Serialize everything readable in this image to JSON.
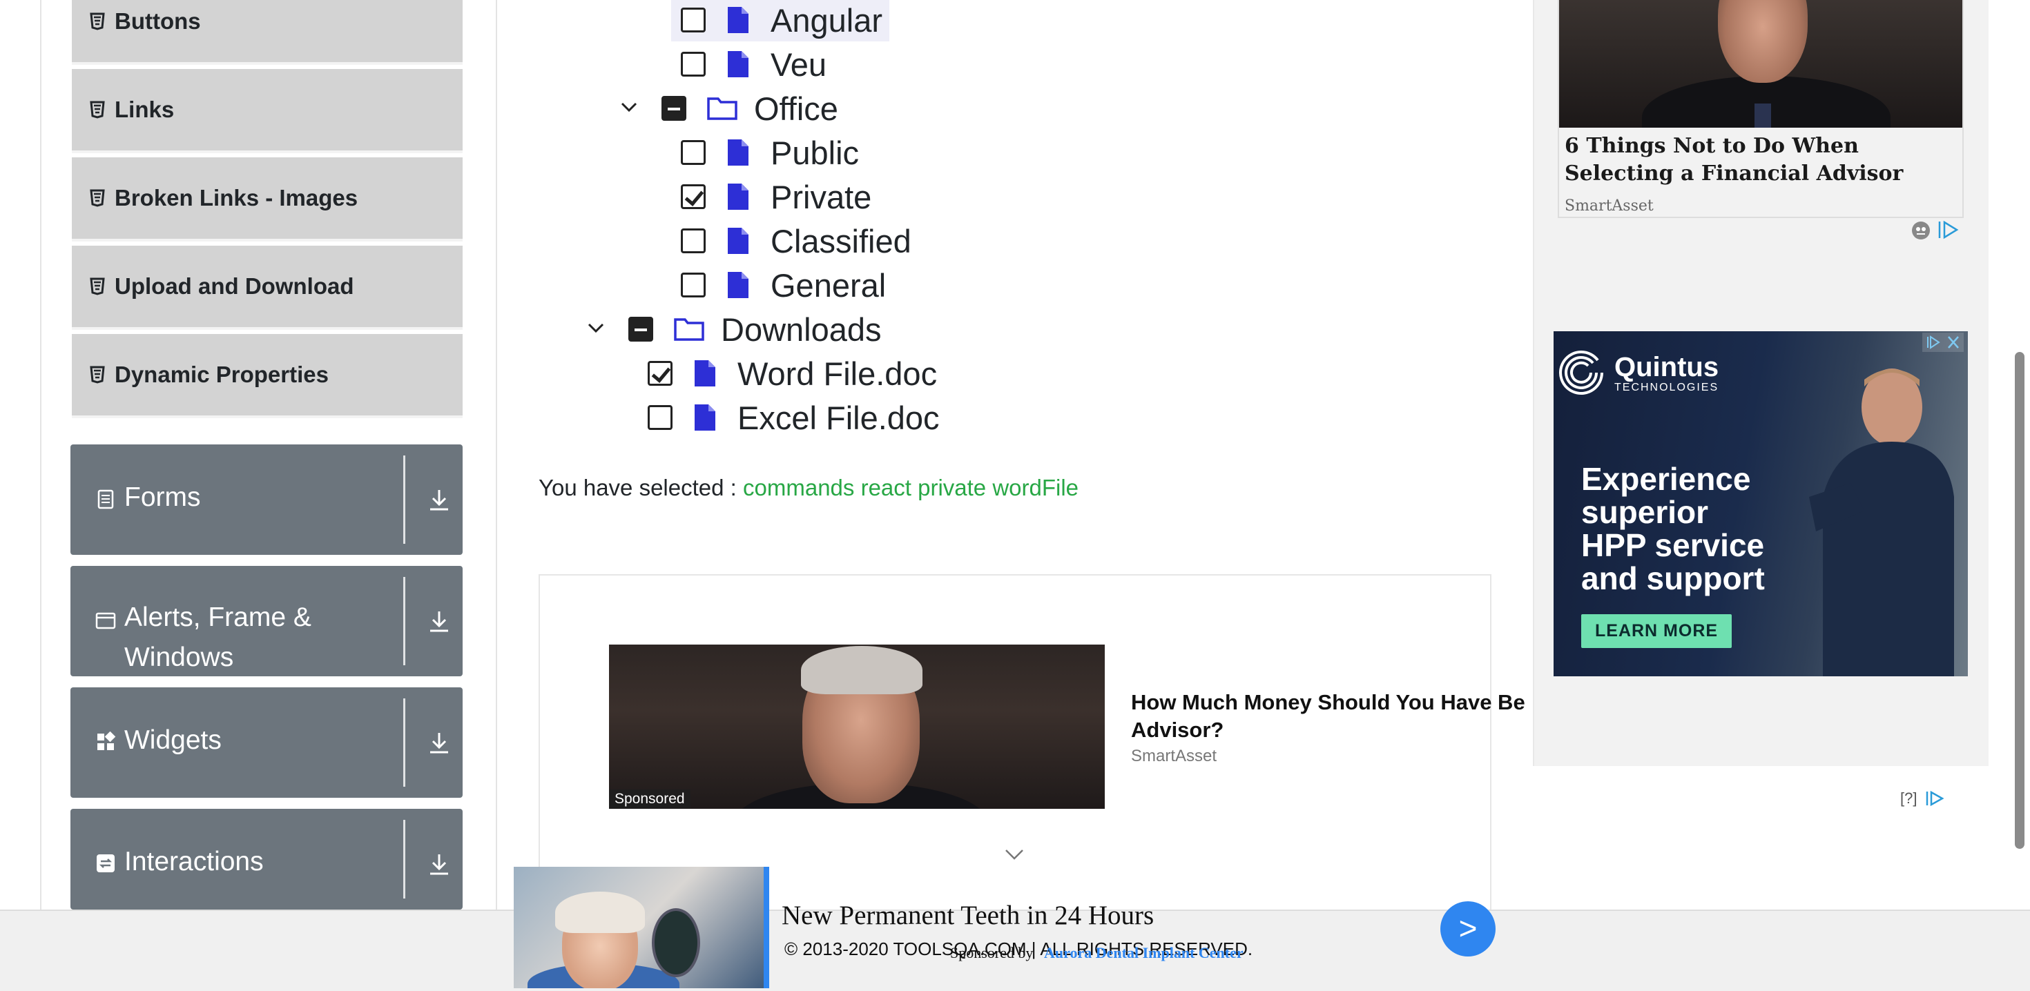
{
  "sidebar": {
    "sub_items": [
      {
        "label": "Buttons"
      },
      {
        "label": "Links"
      },
      {
        "label": "Broken Links - Images"
      },
      {
        "label": "Upload and Download"
      },
      {
        "label": "Dynamic Properties"
      }
    ],
    "groups": [
      {
        "label": "Forms",
        "icon": "form-icon"
      },
      {
        "label": "Alerts, Frame &",
        "label2": "Windows",
        "icon": "window-icon"
      },
      {
        "label": "Widgets",
        "icon": "widgets-icon"
      },
      {
        "label": "Interactions",
        "icon": "interactions-icon"
      }
    ]
  },
  "tree": {
    "items": [
      {
        "label": "Angular",
        "state": "unchecked",
        "kind": "file"
      },
      {
        "label": "Veu",
        "state": "unchecked",
        "kind": "file"
      },
      {
        "label": "Office",
        "state": "half",
        "kind": "folder",
        "expanded": true
      },
      {
        "label": "Public",
        "state": "unchecked",
        "kind": "file"
      },
      {
        "label": "Private",
        "state": "checked",
        "kind": "file"
      },
      {
        "label": "Classified",
        "state": "unchecked",
        "kind": "file"
      },
      {
        "label": "General",
        "state": "unchecked",
        "kind": "file"
      },
      {
        "label": "Downloads",
        "state": "half",
        "kind": "folder",
        "expanded": true
      },
      {
        "label": "Word File.doc",
        "state": "checked",
        "kind": "file"
      },
      {
        "label": "Excel File.doc",
        "state": "unchecked",
        "kind": "file"
      }
    ]
  },
  "result": {
    "prefix": "You have selected :",
    "values": "commands react private wordFile"
  },
  "ad_center": {
    "sponsored": "Sponsored",
    "headline": "How Much Money Should You Have Be",
    "headline2": "Advisor?",
    "source": "SmartAsset",
    "help": "[?]"
  },
  "ad_right_top": {
    "title": "6 Things Not to Do When Selecting a Financial Advisor",
    "source": "SmartAsset"
  },
  "ad_right_banner": {
    "brand": "Quintus",
    "brand_sub": "TECHNOLOGIES",
    "copy_lines": [
      "Experience",
      "superior",
      "HPP service",
      "and support"
    ],
    "cta": "LEARN MORE"
  },
  "footer": {
    "copyright": "© 2013-2020 TOOLSQA.COM | ALL RIGHTS RESERVED."
  },
  "sticky_ad": {
    "title": "New Permanent Teeth in 24 Hours",
    "sponsor_prefix": "Sponsored by",
    "sponsor_link": "Aurora Dental Implant Center",
    "go": ">"
  },
  "colors": {
    "sidebar_group": "#6c757d",
    "sidebar_sub": "#d3d3d3",
    "selected_green": "#28a745",
    "file_icon": "#2d2fd6",
    "accent_blue": "#2f86f0"
  }
}
